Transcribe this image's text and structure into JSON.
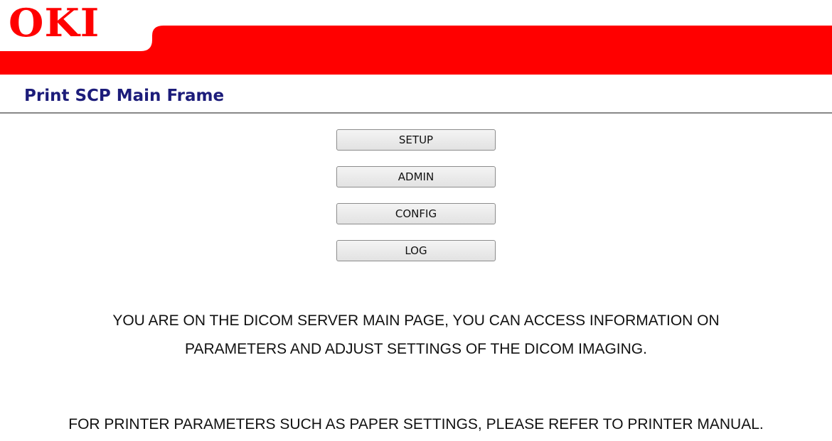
{
  "colors": {
    "brand_red": "#ff0000",
    "title_navy": "#1c1c7a",
    "divider_gray": "#888888"
  },
  "header": {
    "logo_text": "OKI"
  },
  "page": {
    "title": "Print SCP Main Frame"
  },
  "menu": {
    "buttons": [
      "SETUP",
      "ADMIN",
      "CONFIG",
      "LOG"
    ]
  },
  "info": {
    "line1": "YOU ARE ON THE DICOM SERVER MAIN PAGE, YOU CAN ACCESS INFORMATION ON",
    "line2": "PARAMETERS AND ADJUST SETTINGS OF THE DICOM IMAGING.",
    "note": "FOR PRINTER PARAMETERS SUCH AS PAPER SETTINGS, PLEASE REFER TO PRINTER MANUAL."
  }
}
